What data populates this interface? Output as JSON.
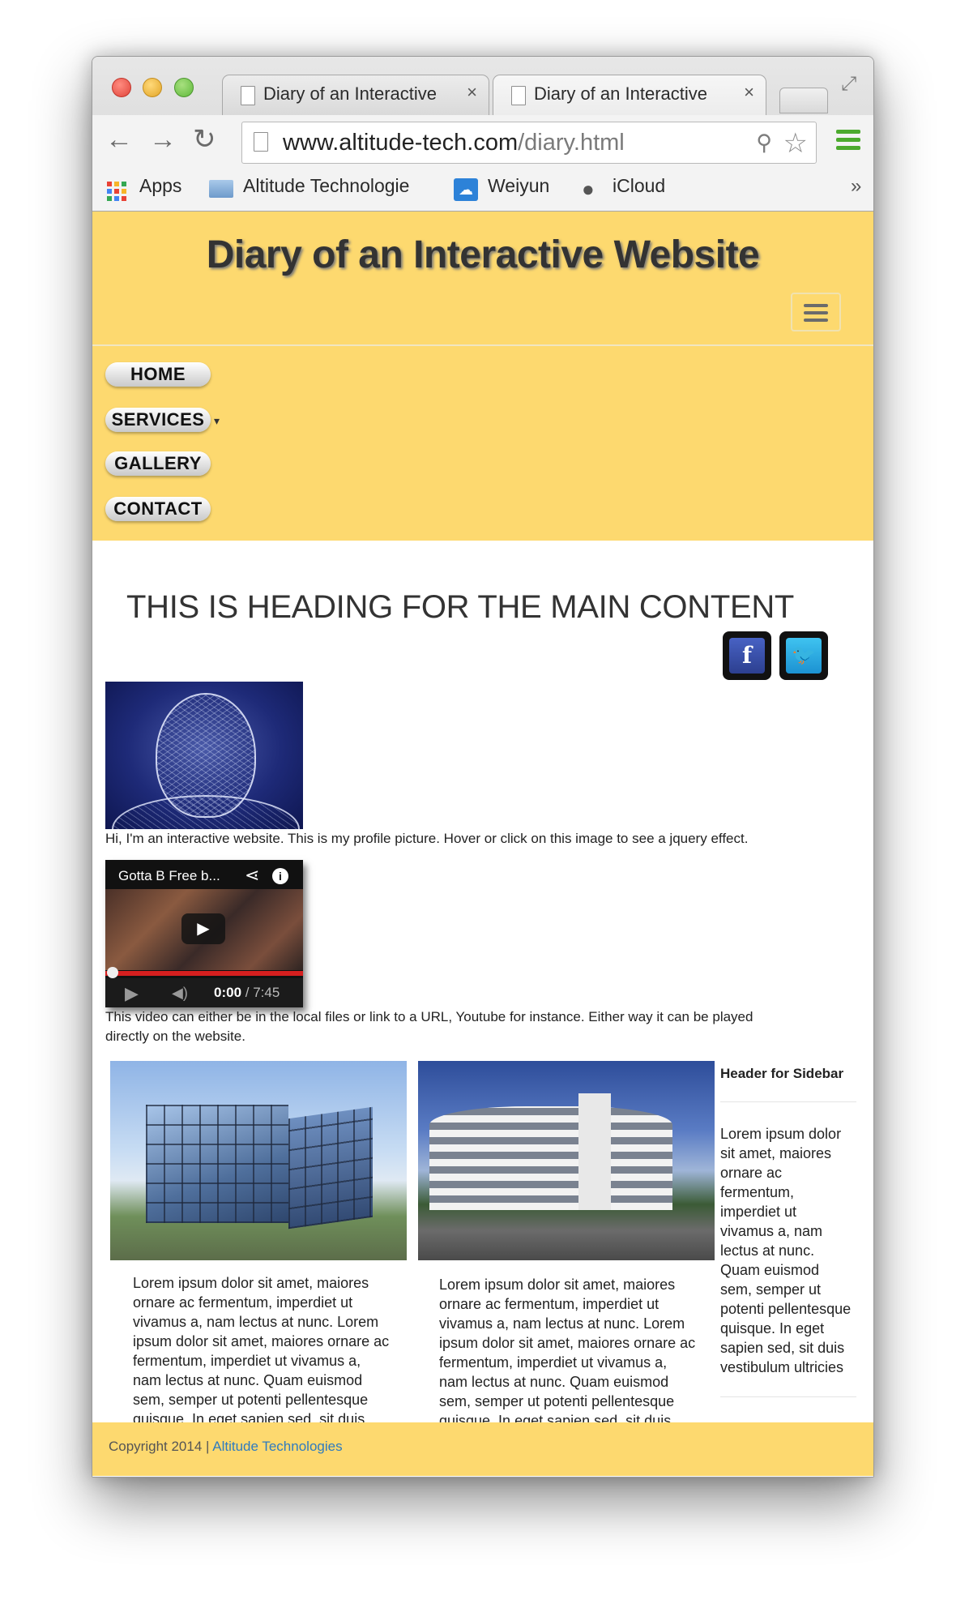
{
  "browser": {
    "tabs": [
      {
        "title": "Diary of an Interactive"
      },
      {
        "title": "Diary of an Interactive"
      }
    ],
    "tab_close": "×",
    "url_host": "www.altitude-tech.com",
    "url_path": "/diary.html",
    "bookmarks": [
      {
        "label": "Apps",
        "icon": "apps-grid-icon"
      },
      {
        "label": "Altitude Technologie",
        "icon": "folder-icon"
      },
      {
        "label": "Weiyun",
        "icon": "weiyun-icon"
      },
      {
        "label": "iCloud",
        "icon": "apple-icon"
      }
    ],
    "bookmarks_more": "»"
  },
  "site": {
    "title": "Diary of an Interactive Website",
    "nav": [
      "HOME",
      "SERVICES",
      "GALLERY",
      "CONTACT"
    ],
    "main_heading": "THIS IS HEADING FOR THE MAIN CONTENT",
    "social": {
      "facebook": "f",
      "twitter": "🐦"
    },
    "profile_caption": "Hi, I'm an interactive website. This is my profile picture. Hover or click on this image to see a jquery effect.",
    "video": {
      "title": "Gotta B Free b...",
      "current_time": "0:00",
      "duration": "/ 7:45"
    },
    "video_caption_lines": [
      "This video can either be in the local files or link to a URL, Youtube for instance. Either way it can be played",
      "directly on the website."
    ],
    "column1_lines": [
      "Lorem ipsum dolor sit amet, maiores",
      "ornare ac fermentum, imperdiet ut",
      "vivamus a, nam lectus at nunc. Lorem",
      "ipsum dolor sit amet, maiores ornare ac",
      "fermentum, imperdiet ut vivamus a,",
      "nam lectus at nunc. Quam euismod",
      "sem, semper ut potenti pellentesque",
      "quisque. In eget sapien sed, sit duis"
    ],
    "column2_lines": [
      "Lorem ipsum dolor sit amet, maiores",
      "ornare ac fermentum, imperdiet ut",
      "vivamus a, nam lectus at nunc. Lorem",
      "ipsum dolor sit amet, maiores ornare ac",
      "fermentum, imperdiet ut vivamus a,",
      "nam lectus at nunc. Quam euismod",
      "sem, semper ut potenti pellentesque",
      "quisque. In eget sapien sed, sit duis"
    ],
    "sidebar": {
      "header": "Header for Sidebar",
      "lines": [
        "Lorem ipsum dolor",
        "sit amet, maiores",
        "ornare ac",
        "fermentum,",
        "imperdiet ut",
        "vivamus a, nam",
        "lectus at nunc.",
        "Quam euismod",
        "sem, semper ut",
        "potenti pellentesque",
        "quisque. In eget",
        "sapien sed, sit duis",
        "vestibulum ultricies"
      ]
    },
    "footer": {
      "copyright": "Copyright 2014 |",
      "link": "Altitude Technologies"
    }
  },
  "colors": {
    "header_yellow": "#fdd96f",
    "link_blue": "#2f7bbf"
  }
}
